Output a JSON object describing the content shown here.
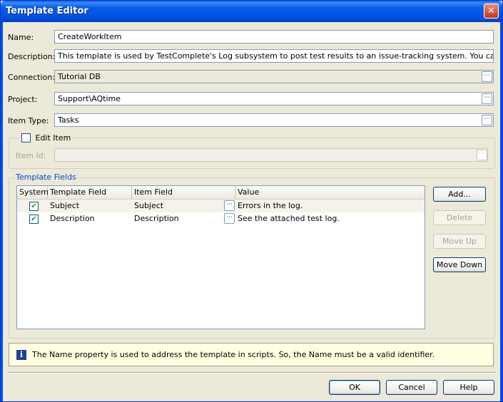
{
  "window": {
    "title": "Template Editor"
  },
  "form": {
    "name_label": "Name:",
    "name_value": "CreateWorkItem",
    "description_label": "Description:",
    "description_value": "This template is used by TestComplete's Log subsystem to post test results to an issue-tracking system. You can also use it at y",
    "connection_label": "Connection:",
    "connection_value": "Tutorial DB",
    "project_label": "Project:",
    "project_value": "Support\\AQtime",
    "item_type_label": "Item Type:",
    "item_type_value": "Tasks"
  },
  "edit_item": {
    "label": "Edit Item",
    "checked": false,
    "item_id_label": "Item Id:",
    "item_id_value": ""
  },
  "template_fields": {
    "title": "Template Fields",
    "columns": [
      "System",
      "Template Field",
      "Item Field",
      "Value"
    ],
    "rows": [
      {
        "system": true,
        "template_field": "Subject",
        "item_field": "Subject",
        "value": "Errors in the log."
      },
      {
        "system": true,
        "template_field": "Description",
        "item_field": "Description",
        "value": "See the attached test log."
      }
    ],
    "buttons": {
      "add": "Add...",
      "delete": "Delete",
      "move_up": "Move Up",
      "move_down": "Move Down"
    }
  },
  "info": {
    "text": "The Name property is used to address the template in scripts. So, the Name must be a valid identifier."
  },
  "footer": {
    "ok": "OK",
    "cancel": "Cancel",
    "help": "Help"
  },
  "icons": {
    "close": "close-icon",
    "ellipsis": "ellipsis-icon",
    "check": "check-icon",
    "info": "info-icon"
  },
  "colors": {
    "titlebar": "#0a5fe7",
    "dialog_bg": "#ece9d8",
    "group_title": "#0046d5",
    "info_bg": "#ffffe1"
  }
}
